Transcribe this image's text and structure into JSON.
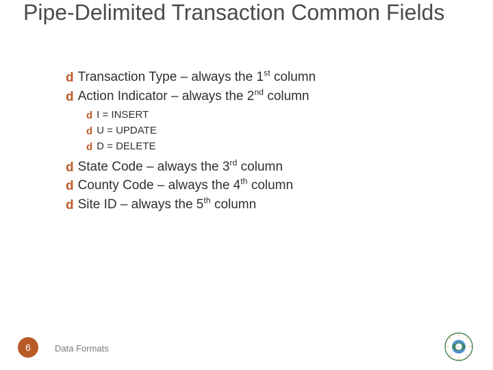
{
  "title": "Pipe-Delimited Transaction Common Fields",
  "bullets": {
    "b1_pre": "Transaction Type – always the 1",
    "b1_sup": "st",
    "b1_post": " column",
    "b2_pre": "Action Indicator – always the 2",
    "b2_sup": "nd",
    "b2_post": " column",
    "b2_children": {
      "c1": "I = INSERT",
      "c2": "U = UPDATE",
      "c3": "D = DELETE"
    },
    "b3_pre": "State Code – always the 3",
    "b3_sup": "rd",
    "b3_post": " column",
    "b4_pre": "County Code – always the 4",
    "b4_sup": "th",
    "b4_post": " column",
    "b5_pre": "Site ID – always the 5",
    "b5_sup": "th",
    "b5_post": " column"
  },
  "bullet_glyph": "d",
  "footer": {
    "page": "6",
    "label": "Data Formats"
  },
  "colors": {
    "accent": "#bd5b29"
  }
}
